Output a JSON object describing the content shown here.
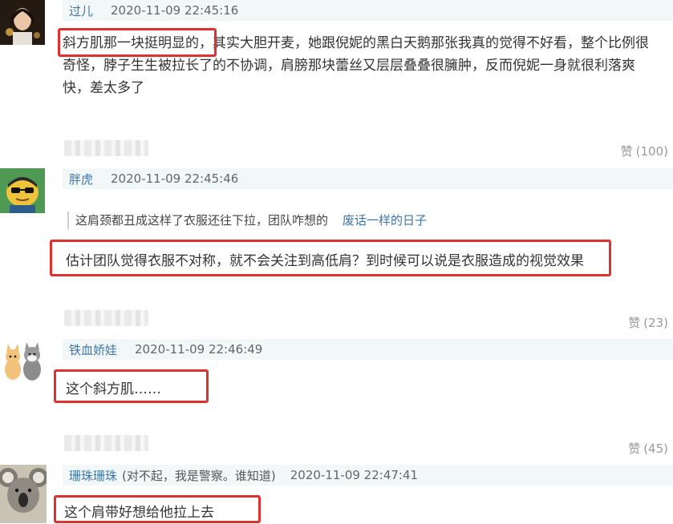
{
  "comments": [
    {
      "name": "过儿",
      "time": "2020-11-09 22:45:16",
      "content_highlight": "斜方肌那一块挺明显的，",
      "content_rest_line1": "其实大胆开麦，她跟倪妮的黑白天鹅那张我真的觉得不好看，整个比例很",
      "content_line2": "奇怪，脖子生生被拉长了的不协调，肩膀那块蕾丝又层层叠叠很臃肿，反而倪妮一身就很利落爽",
      "content_line3": "快，差太多了",
      "like_label": "赞",
      "like_count": "(100)"
    },
    {
      "name": "胖虎",
      "time": "2020-11-09 22:45:46",
      "quote_text": "这肩颈都丑成这样了衣服还往下拉，团队咋想的",
      "quote_name": "废话一样的日子",
      "content": "估计团队觉得衣服不对称，就不会关注到高低肩？到时候可以说是衣服造成的视觉效果",
      "like_label": "赞",
      "like_count": "(23)"
    },
    {
      "name": "铁血娇娃",
      "time": "2020-11-09 22:46:49",
      "content": "这个斜方肌……",
      "like_label": "赞",
      "like_count": "(45)"
    },
    {
      "name": "珊珠珊珠",
      "note": "(对不起，我是警察。谁知道)",
      "time": "2020-11-09 22:47:41",
      "content": "这个肩带好想给他拉上去"
    }
  ],
  "colors": {
    "username": "#3e76a7",
    "header_bg": "#f2f7f7",
    "highlight_border": "#e03131",
    "like_text": "#999999"
  }
}
